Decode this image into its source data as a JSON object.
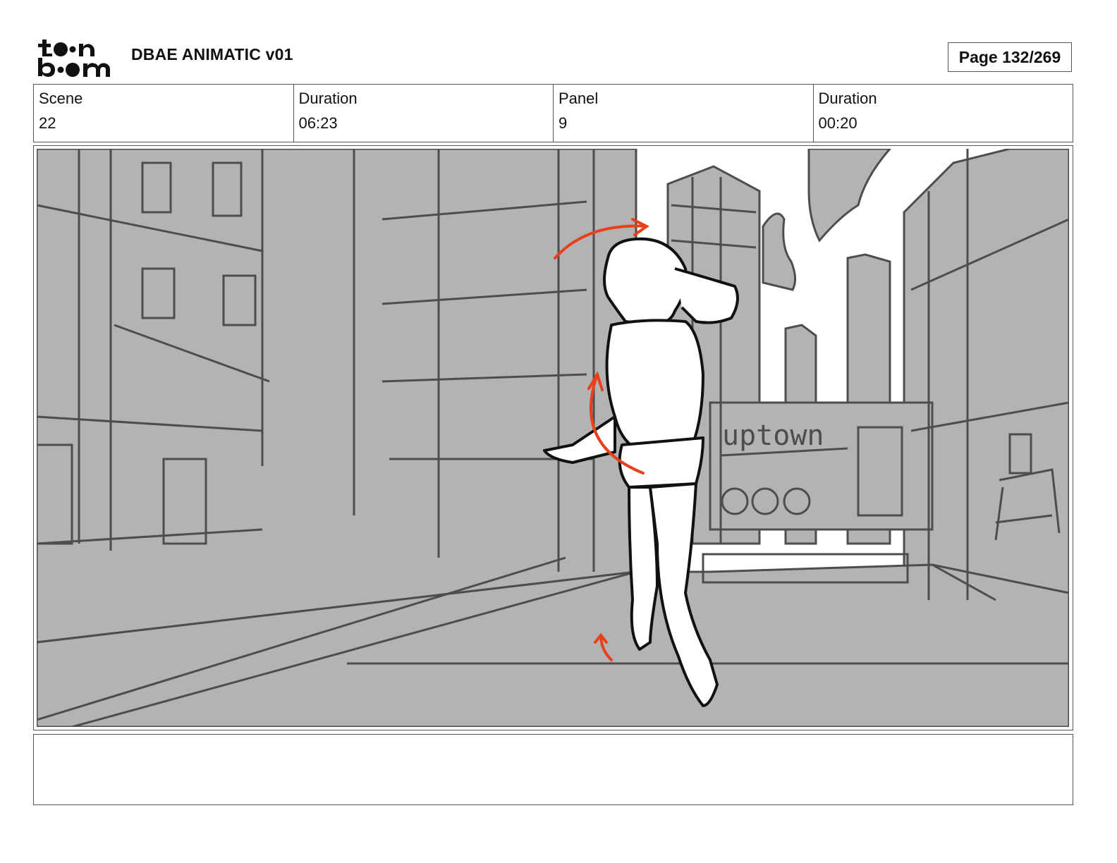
{
  "header": {
    "logo_text": "toon boom",
    "project_title": "DBAE ANIMATIC v01",
    "page_indicator": "Page 132/269"
  },
  "info": [
    {
      "label": "Scene",
      "value": "22"
    },
    {
      "label": "Duration",
      "value": "06:23"
    },
    {
      "label": "Panel",
      "value": "9"
    },
    {
      "label": "Duration",
      "value": "00:20"
    }
  ],
  "panel": {
    "sign_text": "uptown",
    "colors": {
      "background": "#b3b3b3",
      "sketch": "#4d4d4d",
      "character": "#ffffff",
      "arrows": "#e8401c"
    }
  },
  "notes": {
    "text": ""
  }
}
